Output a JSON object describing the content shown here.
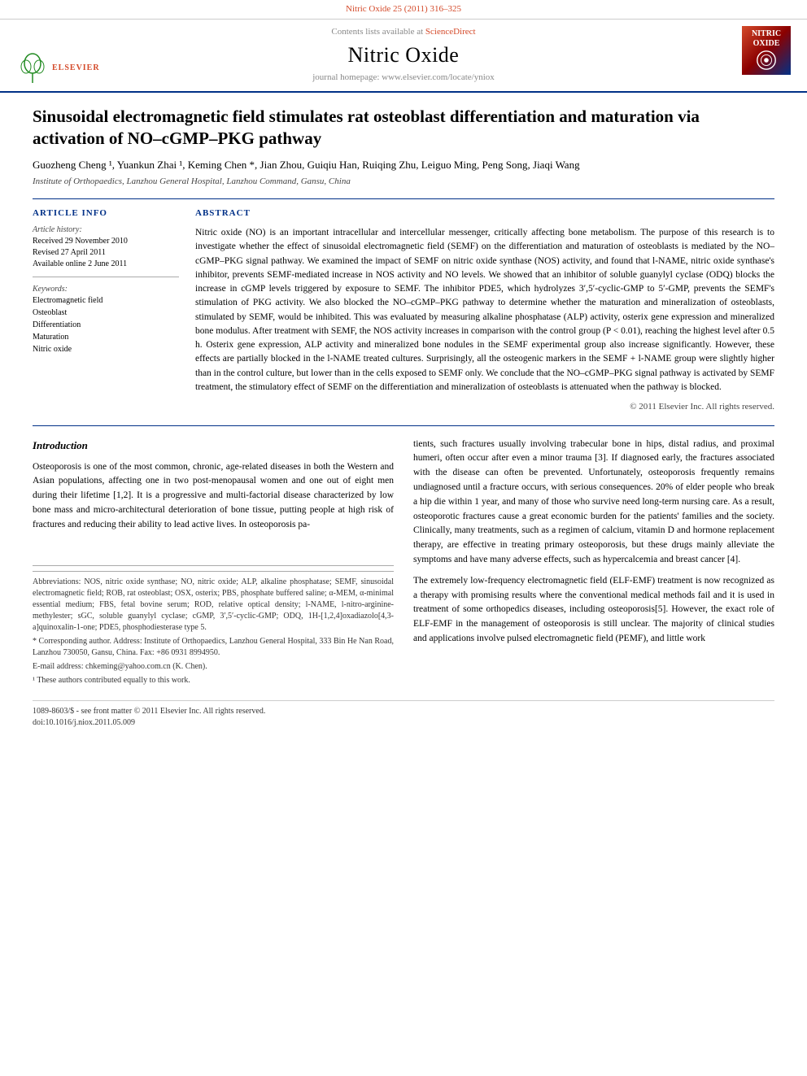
{
  "journal": {
    "top_bar_text": "Nitric Oxide 25 (2011) 316–325",
    "sciencedirect_label": "Contents lists available at",
    "sciencedirect_link": "ScienceDirect",
    "title": "Nitric Oxide",
    "homepage_label": "journal homepage: www.elsevier.com/locate/yniox",
    "elsevier_label": "ELSEVIER",
    "logo_lines": [
      "NITRIC",
      "OXIDE"
    ]
  },
  "article": {
    "title": "Sinusoidal electromagnetic field stimulates rat osteoblast differentiation and maturation via activation of NO–cGMP–PKG pathway",
    "authors": "Guozheng Cheng ¹, Yuankun Zhai ¹, Keming Chen *, Jian Zhou, Guiqiu Han, Ruiqing Zhu, Leiguo Ming, Peng Song, Jiaqi Wang",
    "affiliation": "Institute of Orthopaedics, Lanzhou General Hospital, Lanzhou Command, Gansu, China"
  },
  "article_info": {
    "section_title": "ARTICLE INFO",
    "history_title": "Article history:",
    "received": "Received 29 November 2010",
    "revised": "Revised 27 April 2011",
    "available": "Available online 2 June 2011",
    "keywords_title": "Keywords:",
    "keywords": [
      "Electromagnetic field",
      "Osteoblast",
      "Differentiation",
      "Maturation",
      "Nitric oxide"
    ]
  },
  "abstract": {
    "section_title": "ABSTRACT",
    "text": "Nitric oxide (NO) is an important intracellular and intercellular messenger, critically affecting bone metabolism. The purpose of this research is to investigate whether the effect of sinusoidal electromagnetic field (SEMF) on the differentiation and maturation of osteoblasts is mediated by the NO–cGMP–PKG signal pathway. We examined the impact of SEMF on nitric oxide synthase (NOS) activity, and found that l-NAME, nitric oxide synthase's inhibitor, prevents SEMF-mediated increase in NOS activity and NO levels. We showed that an inhibitor of soluble guanylyl cyclase (ODQ) blocks the increase in cGMP levels triggered by exposure to SEMF. The inhibitor PDE5, which hydrolyzes 3′,5′-cyclic-GMP to 5′-GMP, prevents the SEMF's stimulation of PKG activity. We also blocked the NO–cGMP–PKG pathway to determine whether the maturation and mineralization of osteoblasts, stimulated by SEMF, would be inhibited. This was evaluated by measuring alkaline phosphatase (ALP) activity, osterix gene expression and mineralized bone modulus. After treatment with SEMF, the NOS activity increases in comparison with the control group (P < 0.01), reaching the highest level after 0.5 h. Osterix gene expression, ALP activity and mineralized bone nodules in the SEMF experimental group also increase significantly. However, these effects are partially blocked in the l-NAME treated cultures. Surprisingly, all the osteogenic markers in the SEMF + l-NAME group were slightly higher than in the control culture, but lower than in the cells exposed to SEMF only. We conclude that the NO–cGMP–PKG signal pathway is activated by SEMF treatment, the stimulatory effect of SEMF on the differentiation and mineralization of osteoblasts is attenuated when the pathway is blocked.",
    "copyright": "© 2011 Elsevier Inc. All rights reserved."
  },
  "introduction": {
    "heading": "Introduction",
    "paragraph1": "Osteoporosis is one of the most common, chronic, age-related diseases in both the Western and Asian populations, affecting one in two post-menopausal women and one out of eight men during their lifetime [1,2]. It is a progressive and multi-factorial disease characterized by low bone mass and micro-architectural deterioration of bone tissue, putting people at high risk of fractures and reducing their ability to lead active lives. In osteoporosis pa-",
    "paragraph2_right": "tients, such fractures usually involving trabecular bone in hips, distal radius, and proximal humeri, often occur after even a minor trauma [3]. If diagnosed early, the fractures associated with the disease can often be prevented. Unfortunately, osteoporosis frequently remains undiagnosed until a fracture occurs, with serious consequences. 20% of elder people who break a hip die within 1 year, and many of those who survive need long-term nursing care. As a result, osteoporotic fractures cause a great economic burden for the patients' families and the society. Clinically, many treatments, such as a regimen of calcium, vitamin D and hormone replacement therapy, are effective in treating primary osteoporosis, but these drugs mainly alleviate the symptoms and have many adverse effects, such as hypercalcemia and breast cancer [4].",
    "paragraph3_right": "The extremely low-frequency electromagnetic field (ELF-EMF) treatment is now recognized as a therapy with promising results where the conventional medical methods fail and it is used in treatment of some orthopedics diseases, including osteoporosis[5]. However, the exact role of ELF-EMF in the management of osteoporosis is still unclear. The majority of clinical studies and applications involve pulsed electromagnetic field (PEMF), and little work"
  },
  "footnotes": {
    "abbreviations": "Abbreviations: NOS, nitric oxide synthase; NO, nitric oxide; ALP, alkaline phosphatase; SEMF, sinusoidal electromagnetic field; ROB, rat osteoblast; OSX, osterix; PBS, phosphate buffered saline; α-MEM, α-minimal essential medium; FBS, fetal bovine serum; ROD, relative optical density; l-NAME, l-nitro-arginine-methylester; sGC, soluble guanylyl cyclase; cGMP, 3′,5′-cyclic-GMP; ODQ, 1H-[1,2,4]oxadiazolo[4,3-a]quinoxalin-1-one; PDE5, phosphodiesterase type 5.",
    "corresponding": "* Corresponding author. Address: Institute of Orthopaedics, Lanzhou General Hospital, 333 Bin He Nan Road, Lanzhou 730050, Gansu, China. Fax: +86 0931 8994950.",
    "email": "E-mail address: chkeming@yahoo.com.cn (K. Chen).",
    "equal_contrib": "¹ These authors contributed equally to this work."
  },
  "bottom_info": {
    "issn": "1089-8603/$ - see front matter © 2011 Elsevier Inc. All rights reserved.",
    "doi": "doi:10.1016/j.niox.2011.05.009"
  }
}
